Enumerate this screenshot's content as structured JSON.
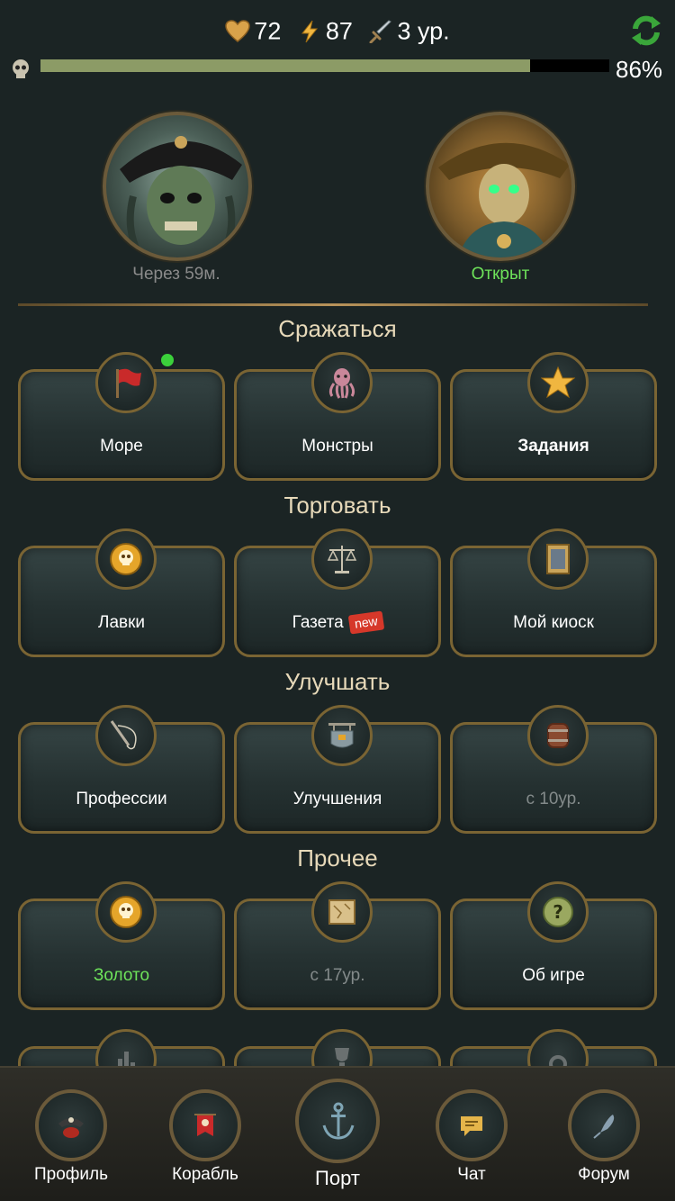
{
  "header": {
    "hearts": "72",
    "energy": "87",
    "level": "3 ур.",
    "progress_percent": 86,
    "progress_label": "86%"
  },
  "bosses": [
    {
      "status": "Через 59м."
    },
    {
      "status": "Открыт"
    }
  ],
  "sections": {
    "fight": {
      "title": "Сражаться",
      "items": [
        "Море",
        "Монстры",
        "Задания"
      ]
    },
    "trade": {
      "title": "Торговать",
      "items": [
        "Лавки",
        "Газета",
        "Мой киоск"
      ],
      "new_tag": "new"
    },
    "improve": {
      "title": "Улучшать",
      "items": [
        "Профессии",
        "Улучшения",
        "с 10ур."
      ]
    },
    "other": {
      "title": "Прочее",
      "items": [
        "Золото",
        "с 17ур.",
        "Об игре"
      ]
    }
  },
  "nav": {
    "profile": "Профиль",
    "ship": "Корабль",
    "port": "Порт",
    "chat": "Чат",
    "forum": "Форум"
  },
  "colors": {
    "background": "#1b2424",
    "accent_gold": "#7a6433",
    "status_green": "#6ee35a",
    "progress_fill": "#8c9b66"
  }
}
